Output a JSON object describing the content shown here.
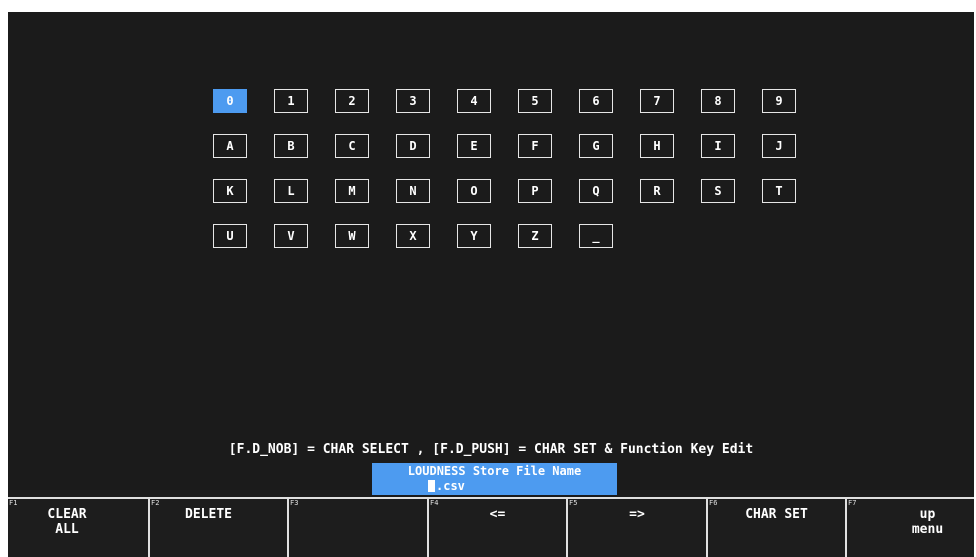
{
  "keyboard": {
    "rows": [
      [
        "0",
        "1",
        "2",
        "3",
        "4",
        "5",
        "6",
        "7",
        "8",
        "9"
      ],
      [
        "A",
        "B",
        "C",
        "D",
        "E",
        "F",
        "G",
        "H",
        "I",
        "J"
      ],
      [
        "K",
        "L",
        "M",
        "N",
        "O",
        "P",
        "Q",
        "R",
        "S",
        "T"
      ],
      [
        "U",
        "V",
        "W",
        "X",
        "Y",
        "Z",
        "_"
      ]
    ],
    "selected": "0"
  },
  "instruction": "[F.D_NOB] = CHAR SELECT , [F.D_PUSH] = CHAR SET & Function Key Edit",
  "filename": {
    "title": "LOUDNESS Store File Name",
    "value": "",
    "extension": ".csv"
  },
  "function_keys": [
    {
      "num": "F1",
      "label": "CLEAR\nALL"
    },
    {
      "num": "F2",
      "label": "DELETE"
    },
    {
      "num": "F3",
      "label": ""
    },
    {
      "num": "F4",
      "label": "<="
    },
    {
      "num": "F5",
      "label": "=>"
    },
    {
      "num": "F6",
      "label": "CHAR SET"
    },
    {
      "num": "F7",
      "label": "up\nmenu"
    }
  ],
  "colors": {
    "background": "#1b1b1b",
    "accent": "#4d9bf0",
    "text": "#ffffff"
  }
}
